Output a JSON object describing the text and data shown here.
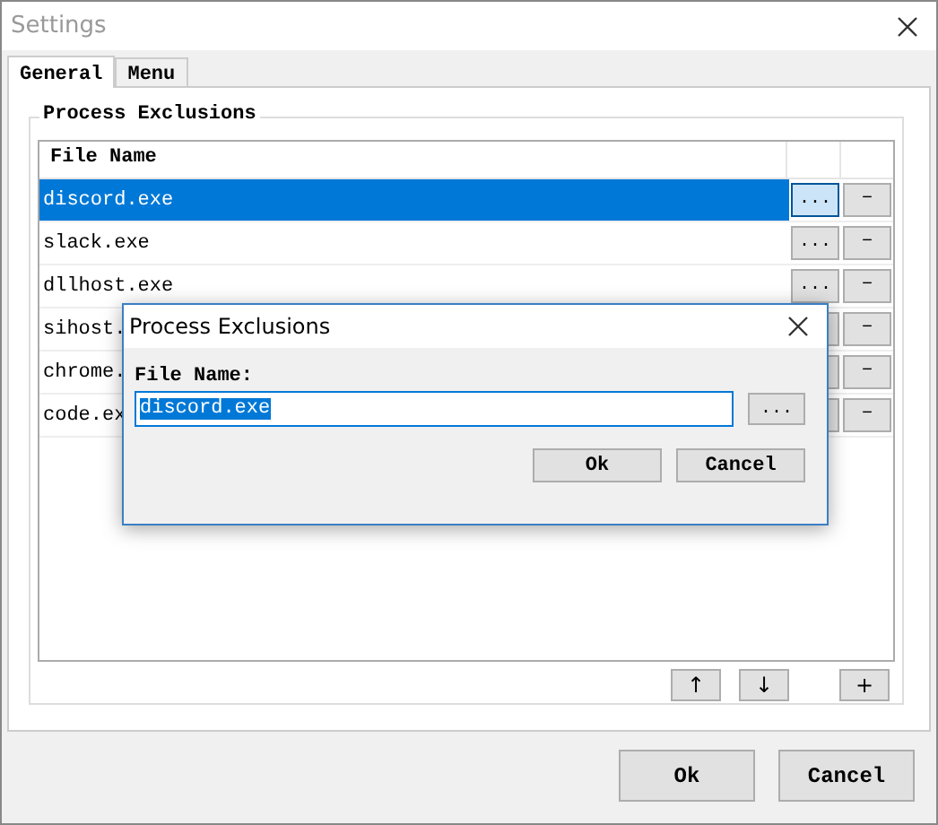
{
  "window": {
    "title": "Settings"
  },
  "tabs": [
    {
      "label": "General",
      "selected": true
    },
    {
      "label": "Menu",
      "selected": false
    }
  ],
  "group": {
    "title": "Process Exclusions",
    "columns": [
      "File Name"
    ],
    "rows": [
      {
        "name": "discord.exe",
        "selected": true,
        "browse": "...",
        "remove": "−"
      },
      {
        "name": "slack.exe",
        "selected": false,
        "browse": "...",
        "remove": "−"
      },
      {
        "name": "dllhost.exe",
        "selected": false,
        "browse": "...",
        "remove": "−"
      },
      {
        "name": "sihost.",
        "selected": false,
        "remove": "−"
      },
      {
        "name": "chrome.",
        "selected": false,
        "remove": "−"
      },
      {
        "name": "code.ex",
        "selected": false,
        "remove": "−"
      }
    ],
    "move_up": "↑",
    "move_down": "↓",
    "add": "+"
  },
  "footer_buttons": [
    "Ok",
    "Cancel"
  ],
  "dialog": {
    "title": "Process Exclusions",
    "field_label": "File Name:",
    "value": "discord.exe",
    "value_selected": true,
    "browse": "...",
    "buttons": [
      "Ok",
      "Cancel"
    ]
  }
}
